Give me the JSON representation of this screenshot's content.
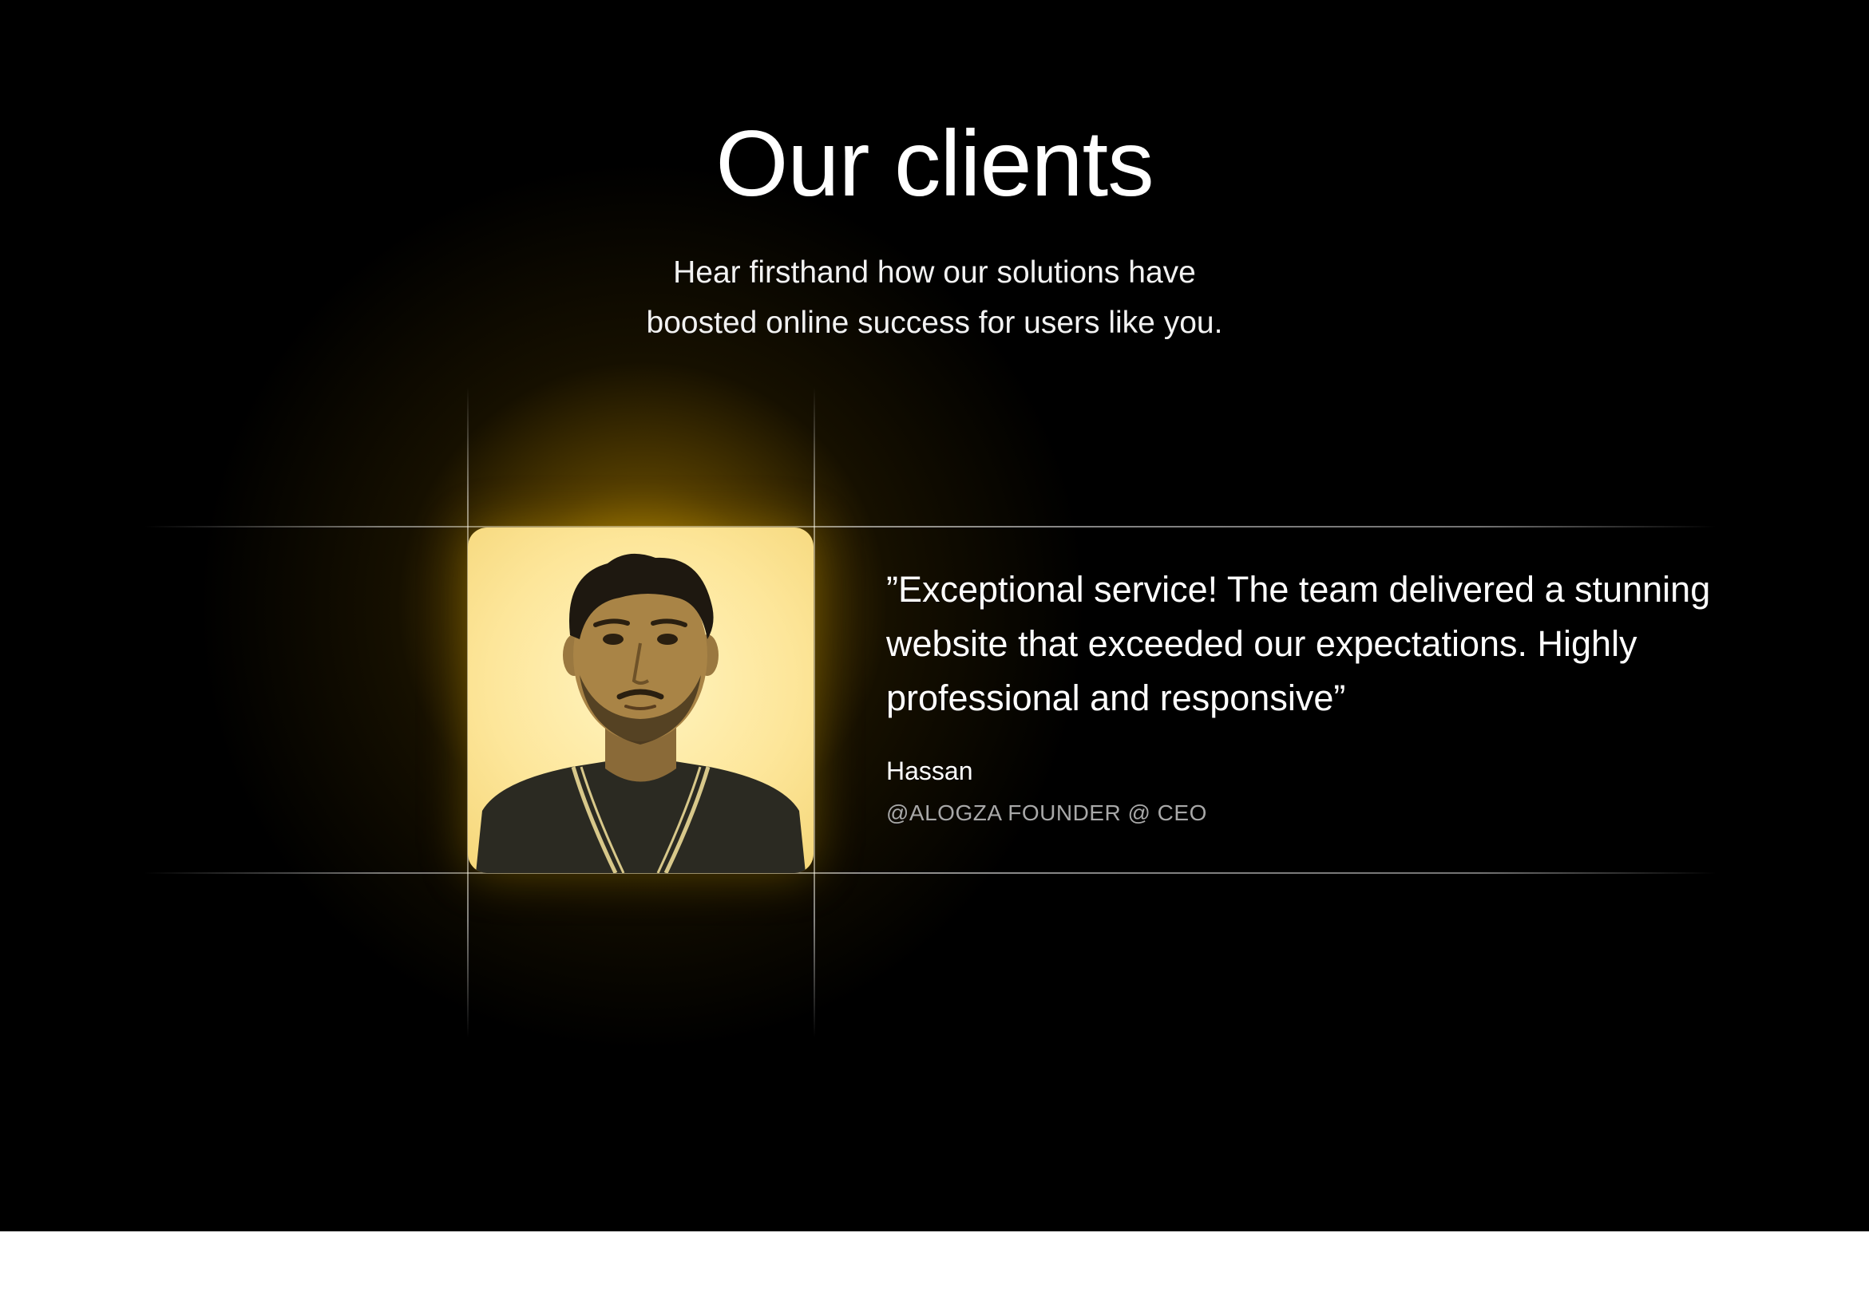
{
  "section": {
    "title": "Our clients",
    "subtitle_lines": [
      "Hear firsthand how our solutions have",
      "boosted online success for users like you."
    ]
  },
  "testimonial": {
    "quote_lines": [
      "”Exceptional service! The team delivered a stunning",
      "website that exceeded our expectations. Highly",
      "professional and responsive”"
    ],
    "author_name": "Hassan",
    "author_role": "@ALOGZA FOUNDER @ CEO",
    "photo_icon": "client-portrait"
  },
  "colors": {
    "background": "#000000",
    "glow": "#c89600",
    "photo_tint": "#fde69a",
    "text_primary": "#ffffff",
    "text_muted": "#a8a8a8"
  }
}
